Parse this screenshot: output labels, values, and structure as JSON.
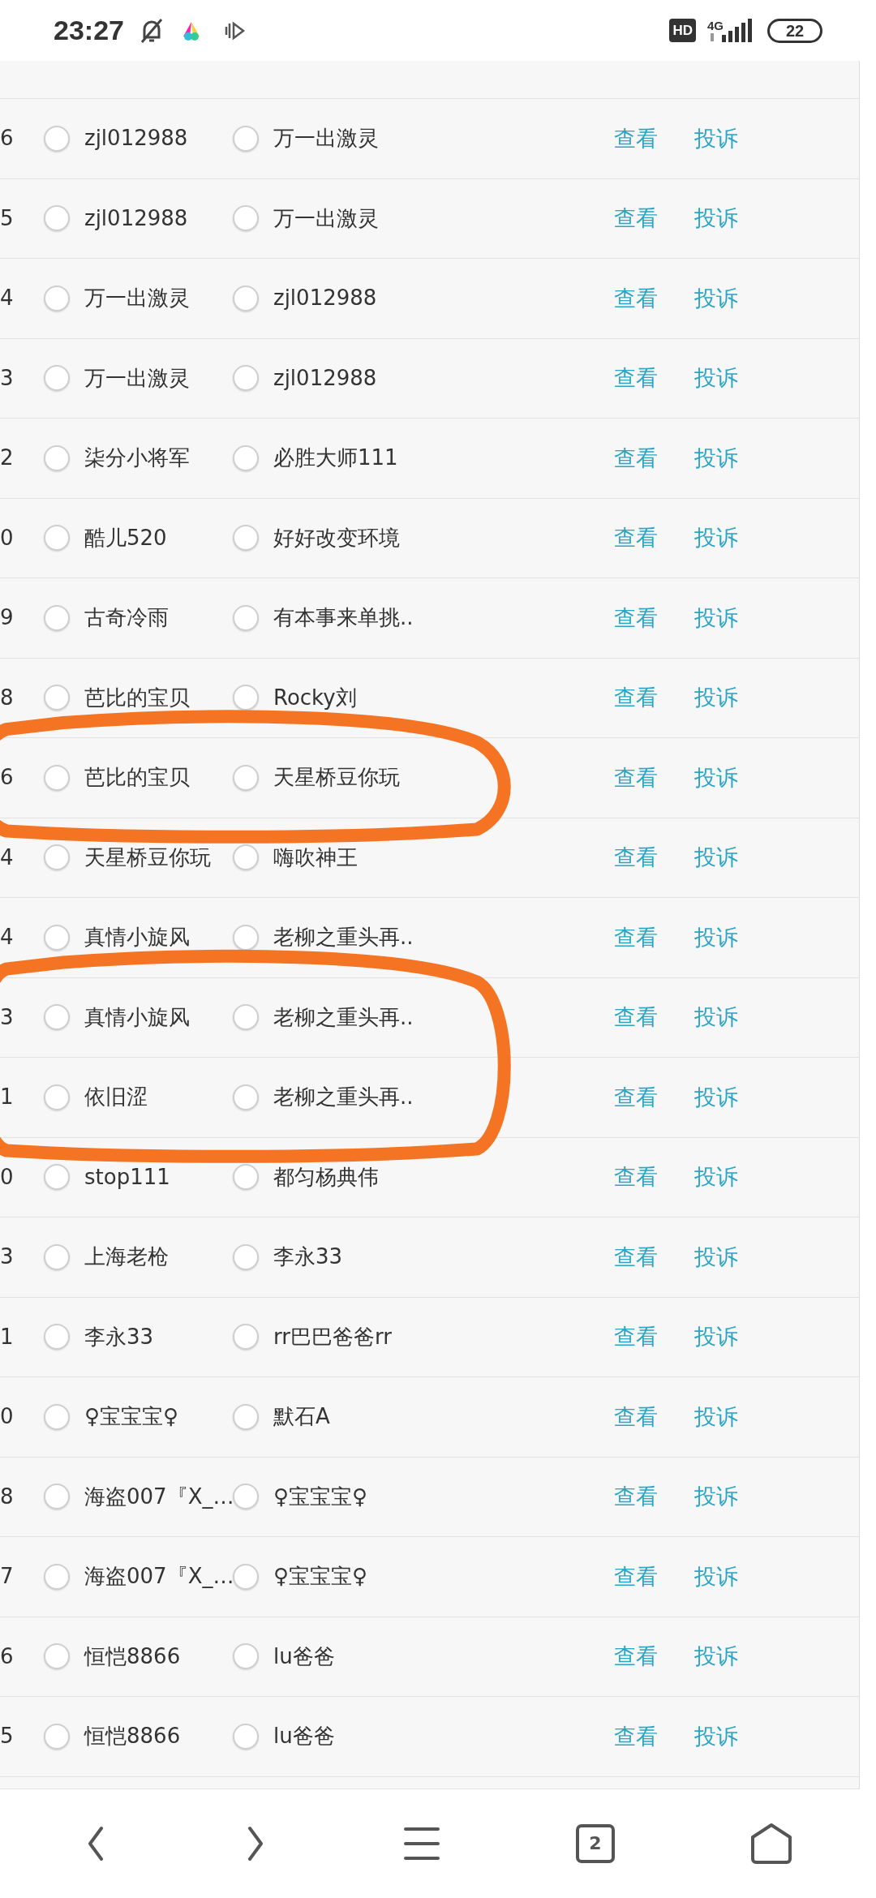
{
  "status_bar": {
    "time": "23:27",
    "network_badge": "HD",
    "network_type": "4G",
    "battery": "22"
  },
  "rows": [
    {
      "number": "6",
      "player_1": {
        "name": "zjl012988",
        "selected": false
      },
      "player_2": {
        "name": "万一出激灵",
        "selected": false
      },
      "view": "查看",
      "report": "投诉",
      "circled": false
    },
    {
      "number": "5",
      "player_1": {
        "name": "zjl012988",
        "selected": false
      },
      "player_2": {
        "name": "万一出激灵",
        "selected": false
      },
      "view": "查看",
      "report": "投诉",
      "circled": false
    },
    {
      "number": "4",
      "player_1": {
        "name": "万一出激灵",
        "selected": false
      },
      "player_2": {
        "name": "zjl012988",
        "selected": false
      },
      "view": "查看",
      "report": "投诉",
      "circled": false
    },
    {
      "number": "3",
      "player_1": {
        "name": "万一出激灵",
        "selected": false
      },
      "player_2": {
        "name": "zjl012988",
        "selected": false
      },
      "view": "查看",
      "report": "投诉",
      "circled": false
    },
    {
      "number": "2",
      "player_1": {
        "name": "柒分小将军",
        "selected": false
      },
      "player_2": {
        "name": "必胜大师111",
        "selected": false
      },
      "view": "查看",
      "report": "投诉",
      "circled": false
    },
    {
      "number": "0",
      "player_1": {
        "name": "酷儿520",
        "selected": false
      },
      "player_2": {
        "name": "好好改变环境",
        "selected": false
      },
      "view": "查看",
      "report": "投诉",
      "circled": false
    },
    {
      "number": "9",
      "player_1": {
        "name": "古奇冷雨",
        "selected": false
      },
      "player_2": {
        "name": "有本事来单挑..",
        "selected": false
      },
      "view": "查看",
      "report": "投诉",
      "circled": false
    },
    {
      "number": "8",
      "player_1": {
        "name": "芭比的宝贝",
        "selected": false
      },
      "player_2": {
        "name": "Rocky刘",
        "selected": false
      },
      "view": "查看",
      "report": "投诉",
      "circled": false
    },
    {
      "number": "6",
      "player_1": {
        "name": "芭比的宝贝",
        "selected": false
      },
      "player_2": {
        "name": "天星桥豆你玩",
        "selected": false
      },
      "view": "查看",
      "report": "投诉",
      "circled": true
    },
    {
      "number": "4",
      "player_1": {
        "name": "天星桥豆你玩",
        "selected": false
      },
      "player_2": {
        "name": "嗨吹神王",
        "selected": false
      },
      "view": "查看",
      "report": "投诉",
      "circled": false
    },
    {
      "number": "4",
      "player_1": {
        "name": "真情小旋风",
        "selected": false
      },
      "player_2": {
        "name": "老柳之重头再..",
        "selected": false
      },
      "view": "查看",
      "report": "投诉",
      "circled": false
    },
    {
      "number": "3",
      "player_1": {
        "name": "真情小旋风",
        "selected": false
      },
      "player_2": {
        "name": "老柳之重头再..",
        "selected": false
      },
      "view": "查看",
      "report": "投诉",
      "circled": true
    },
    {
      "number": "1",
      "player_1": {
        "name": "依旧涩",
        "selected": false
      },
      "player_2": {
        "name": "老柳之重头再..",
        "selected": false
      },
      "view": "查看",
      "report": "投诉",
      "circled": true
    },
    {
      "number": "0",
      "player_1": {
        "name": "stop111",
        "selected": false
      },
      "player_2": {
        "name": "都匀杨典伟",
        "selected": false
      },
      "view": "查看",
      "report": "投诉",
      "circled": false
    },
    {
      "number": "3",
      "player_1": {
        "name": "上海老枪",
        "selected": false
      },
      "player_2": {
        "name": "李永33",
        "selected": false
      },
      "view": "查看",
      "report": "投诉",
      "circled": false
    },
    {
      "number": "1",
      "player_1": {
        "name": "李永33",
        "selected": false
      },
      "player_2": {
        "name": "rr巴巴爸爸rr",
        "selected": false
      },
      "view": "查看",
      "report": "投诉",
      "circled": false
    },
    {
      "number": "0",
      "player_1": {
        "name": "♀宝宝宝♀",
        "selected": false
      },
      "player_2": {
        "name": "默石A",
        "selected": false
      },
      "view": "查看",
      "report": "投诉",
      "circled": false
    },
    {
      "number": "8",
      "player_1": {
        "name": "海盗007『X_…",
        "selected": false
      },
      "player_2": {
        "name": "♀宝宝宝♀",
        "selected": false
      },
      "view": "查看",
      "report": "投诉",
      "circled": false
    },
    {
      "number": "7",
      "player_1": {
        "name": "海盗007『X_…",
        "selected": false
      },
      "player_2": {
        "name": "♀宝宝宝♀",
        "selected": false
      },
      "view": "查看",
      "report": "投诉",
      "circled": false
    },
    {
      "number": "6",
      "player_1": {
        "name": "恒恺8866",
        "selected": false
      },
      "player_2": {
        "name": "lu爸爸",
        "selected": false
      },
      "view": "查看",
      "report": "投诉",
      "circled": false
    },
    {
      "number": "5",
      "player_1": {
        "name": "恒恺8866",
        "selected": false
      },
      "player_2": {
        "name": "lu爸爸",
        "selected": false
      },
      "view": "查看",
      "report": "投诉",
      "circled": false
    }
  ],
  "bottom_nav": {
    "tab_count": "2"
  }
}
